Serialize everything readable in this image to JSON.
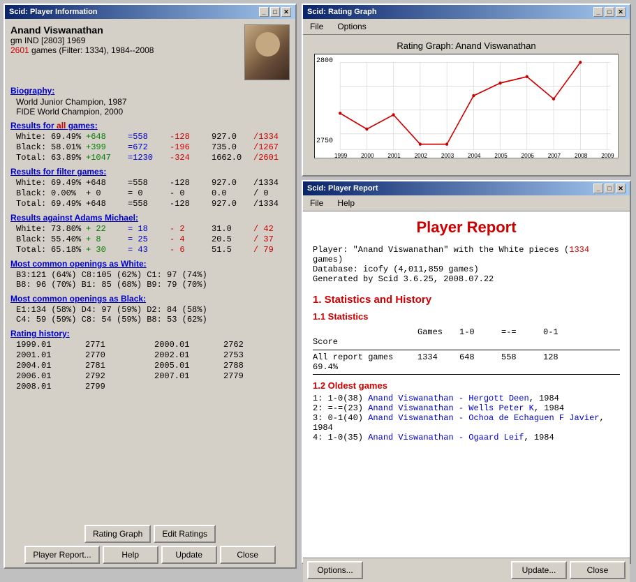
{
  "playerInfo": {
    "windowTitle": "Scid: Player Information",
    "playerName": "Anand Viswanathan",
    "playerDetails": "gm  IND [2803] 1969",
    "gamesLine": "2601 games (Filter: 1334), 1984--2008",
    "gamesHighlight": "2601",
    "biographyTitle": "Biography:",
    "bio1": "World Junior Champion, 1987",
    "bio2": "FIDE World Champion, 2000",
    "allGamesTitle": "Results for all games:",
    "allGames": {
      "white": {
        "label": "White:",
        "pct": "69.49%",
        "plus": "+648",
        "eq": "=558",
        "minus": "-128",
        "score": "927.0",
        "total": "/1334"
      },
      "black": {
        "label": "Black:",
        "pct": "58.01%",
        "plus": "+399",
        "eq": "=672",
        "minus": "-196",
        "score": "735.0",
        "total": "/1267"
      },
      "total": {
        "label": "Total:",
        "pct": "63.89%",
        "plus": "+1047",
        "eq": "=1230",
        "minus": "-324",
        "score": "1662.0",
        "total": "/2601"
      }
    },
    "filterGamesTitle": "Results for filter games:",
    "filterGames": {
      "white": {
        "label": "White:",
        "pct": "69.49%",
        "plus": "+648",
        "eq": "=558",
        "minus": "-128",
        "score": "927.0",
        "total": "/1334"
      },
      "black": {
        "label": "Black:",
        "pct": "0.00%",
        "plus": "+ 0",
        "eq": "= 0",
        "minus": "- 0",
        "score": "0.0",
        "total": "/ 0"
      },
      "total": {
        "label": "Total:",
        "pct": "69.49%",
        "plus": "+648",
        "eq": "=558",
        "minus": "-128",
        "score": "927.0",
        "total": "/1334"
      }
    },
    "againstTitle": "Results against Adams Michael:",
    "againstGames": {
      "white": {
        "label": "White:",
        "pct": "73.80%",
        "plus": "+ 22",
        "eq": "= 18",
        "minus": "- 2",
        "score": "31.0",
        "total": "/ 42"
      },
      "black": {
        "label": "Black:",
        "pct": "55.40%",
        "plus": "+ 8",
        "eq": "= 25",
        "minus": "- 4",
        "score": "20.5",
        "total": "/ 37"
      },
      "total": {
        "label": "Total:",
        "pct": "65.18%",
        "plus": "+ 30",
        "eq": "= 43",
        "minus": "- 6",
        "score": "51.5",
        "total": "/ 79"
      }
    },
    "openingsWhiteTitle": "Most common openings as White:",
    "openingsWhite": [
      "B3:121 (64%)  C8:105 (62%)  C1: 97 (74%)",
      "B8: 96 (70%)  B1: 85 (68%)  B9: 79 (70%)"
    ],
    "openingsBlackTitle": "Most common openings as Black:",
    "openingsBlack": [
      "E1:134 (58%)  D4: 97 (59%)  D2: 84 (58%)",
      "C4: 59 (59%)  C8: 54 (59%)  B8: 53 (62%)"
    ],
    "ratingHistoryTitle": "Rating history:",
    "ratingHistory": [
      [
        "1999.01",
        "2771",
        "2000.01",
        "2762"
      ],
      [
        "2001.01",
        "2770",
        "2002.01",
        "2753"
      ],
      [
        "2004.01",
        "2781",
        "2005.01",
        "2788"
      ],
      [
        "2006.01",
        "2792",
        "2007.01",
        "2779"
      ],
      [
        "2008.01",
        "2799",
        "",
        ""
      ]
    ],
    "buttons": {
      "ratingGraph": "Rating Graph",
      "editRatings": "Edit Ratings",
      "playerReport": "Player Report...",
      "help": "Help",
      "update": "Update",
      "close": "Close"
    }
  },
  "ratingGraph": {
    "windowTitle": "Scid: Rating Graph",
    "menuFile": "File",
    "menuOptions": "Options",
    "graphTitle": "Rating Graph: Anand Viswanathan",
    "yAxisTop": "2800",
    "yAxisBottom": "2750",
    "xLabels": [
      "1999",
      "2000",
      "2001",
      "2002",
      "2003",
      "2004",
      "2005",
      "2006",
      "2007",
      "2008",
      "2009"
    ],
    "dataPoints": [
      {
        "year": 1999,
        "rating": 2771
      },
      {
        "year": 2000,
        "rating": 2762
      },
      {
        "year": 2001,
        "rating": 2770
      },
      {
        "year": 2002,
        "rating": 2753
      },
      {
        "year": 2003,
        "rating": 2753
      },
      {
        "year": 2004,
        "rating": 2781
      },
      {
        "year": 2005,
        "rating": 2788
      },
      {
        "year": 2006,
        "rating": 2792
      },
      {
        "year": 2007,
        "rating": 2779
      },
      {
        "year": 2008,
        "rating": 2800
      }
    ]
  },
  "playerReport": {
    "windowTitle": "Scid: Player Report",
    "menuFile": "File",
    "menuHelp": "Help",
    "reportTitle": "Player Report",
    "playerLine": "Player: \"Anand Viswanathan\" with the White pieces (1334 games)",
    "databaseLine": "Database: icofy (4,011,859 games)",
    "generatedLine": "Generated by Scid 3.6.25, 2008.07.22",
    "section1": "1. Statistics and History",
    "section1_1": "1.1 Statistics",
    "tableHeaders": [
      "Games",
      "1-0",
      "=-=",
      "0-1",
      "Score"
    ],
    "tableRow": [
      "All report games",
      "1334",
      "648",
      "558",
      "128",
      "69.4%"
    ],
    "section1_2": "1.2 Oldest games",
    "games": [
      "1:  1-0(38) Anand Viswanathan - Hergott Deen,  1984",
      "2:  =-=(23) Anand Viswanathan - Wells Peter K,  1984",
      "3:  0-1(40) Anand Viswanathan - Ochoa de Echaguen F Javier,  1984",
      "4:  1-0(35) Anand Viswanathan - Ogaard Leif,  1984"
    ],
    "bottomButtons": {
      "options": "Options...",
      "update": "Update...",
      "close": "Close"
    }
  },
  "icons": {
    "minimize": "_",
    "maximize": "□",
    "close": "✕"
  }
}
